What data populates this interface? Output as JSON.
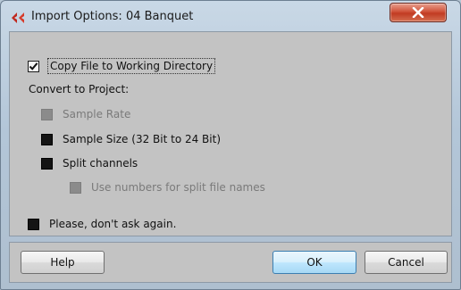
{
  "window": {
    "title": "Import Options: 04 Banquet"
  },
  "options": {
    "copy_file": {
      "label": "Copy File to Working Directory",
      "checked": true
    },
    "convert_heading": "Convert to Project:",
    "sample_rate": {
      "label": "Sample Rate",
      "enabled": false
    },
    "sample_size": {
      "label": "Sample Size (32 Bit to 24 Bit)"
    },
    "split_channels": {
      "label": "Split channels"
    },
    "use_numbers": {
      "label": "Use numbers for split file names",
      "enabled": false
    },
    "dont_ask": {
      "label": "Please, don't ask again."
    }
  },
  "buttons": {
    "help": "Help",
    "ok": "OK",
    "cancel": "Cancel"
  },
  "icons": {
    "app": "red-arrows-icon",
    "close": "close-x-icon",
    "check": "checkmark-icon"
  }
}
